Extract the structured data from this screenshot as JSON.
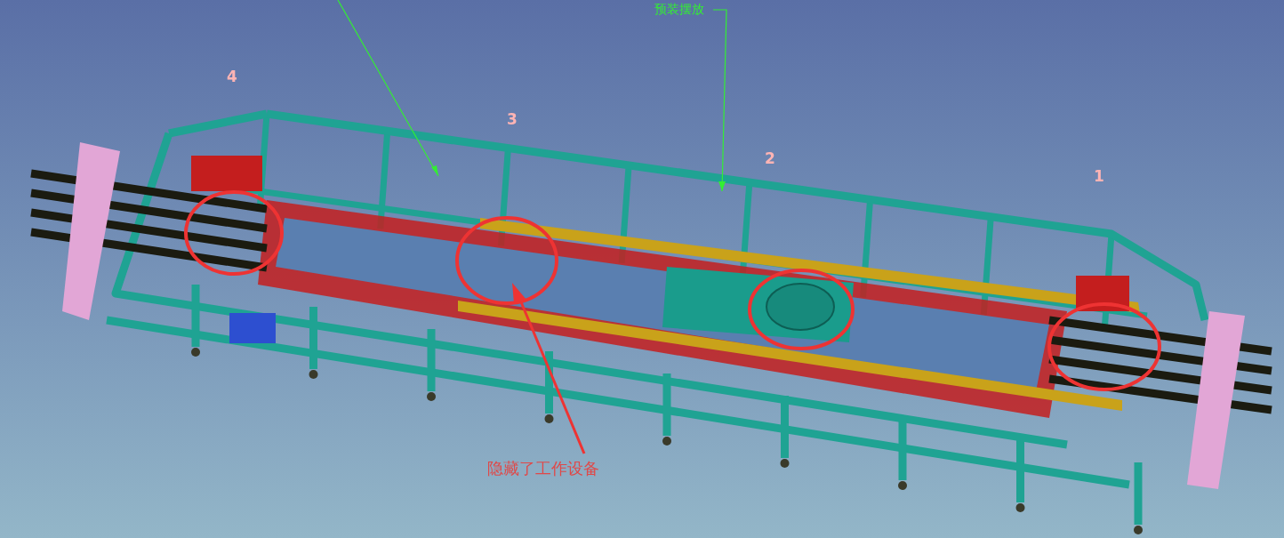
{
  "station_numbers": [
    {
      "text": "4"
    },
    {
      "text": "3"
    },
    {
      "text": "2"
    },
    {
      "text": "1"
    }
  ],
  "callouts": [
    {
      "text": "预装摆放"
    }
  ],
  "note": {
    "text": "隐藏了工作设备"
  }
}
